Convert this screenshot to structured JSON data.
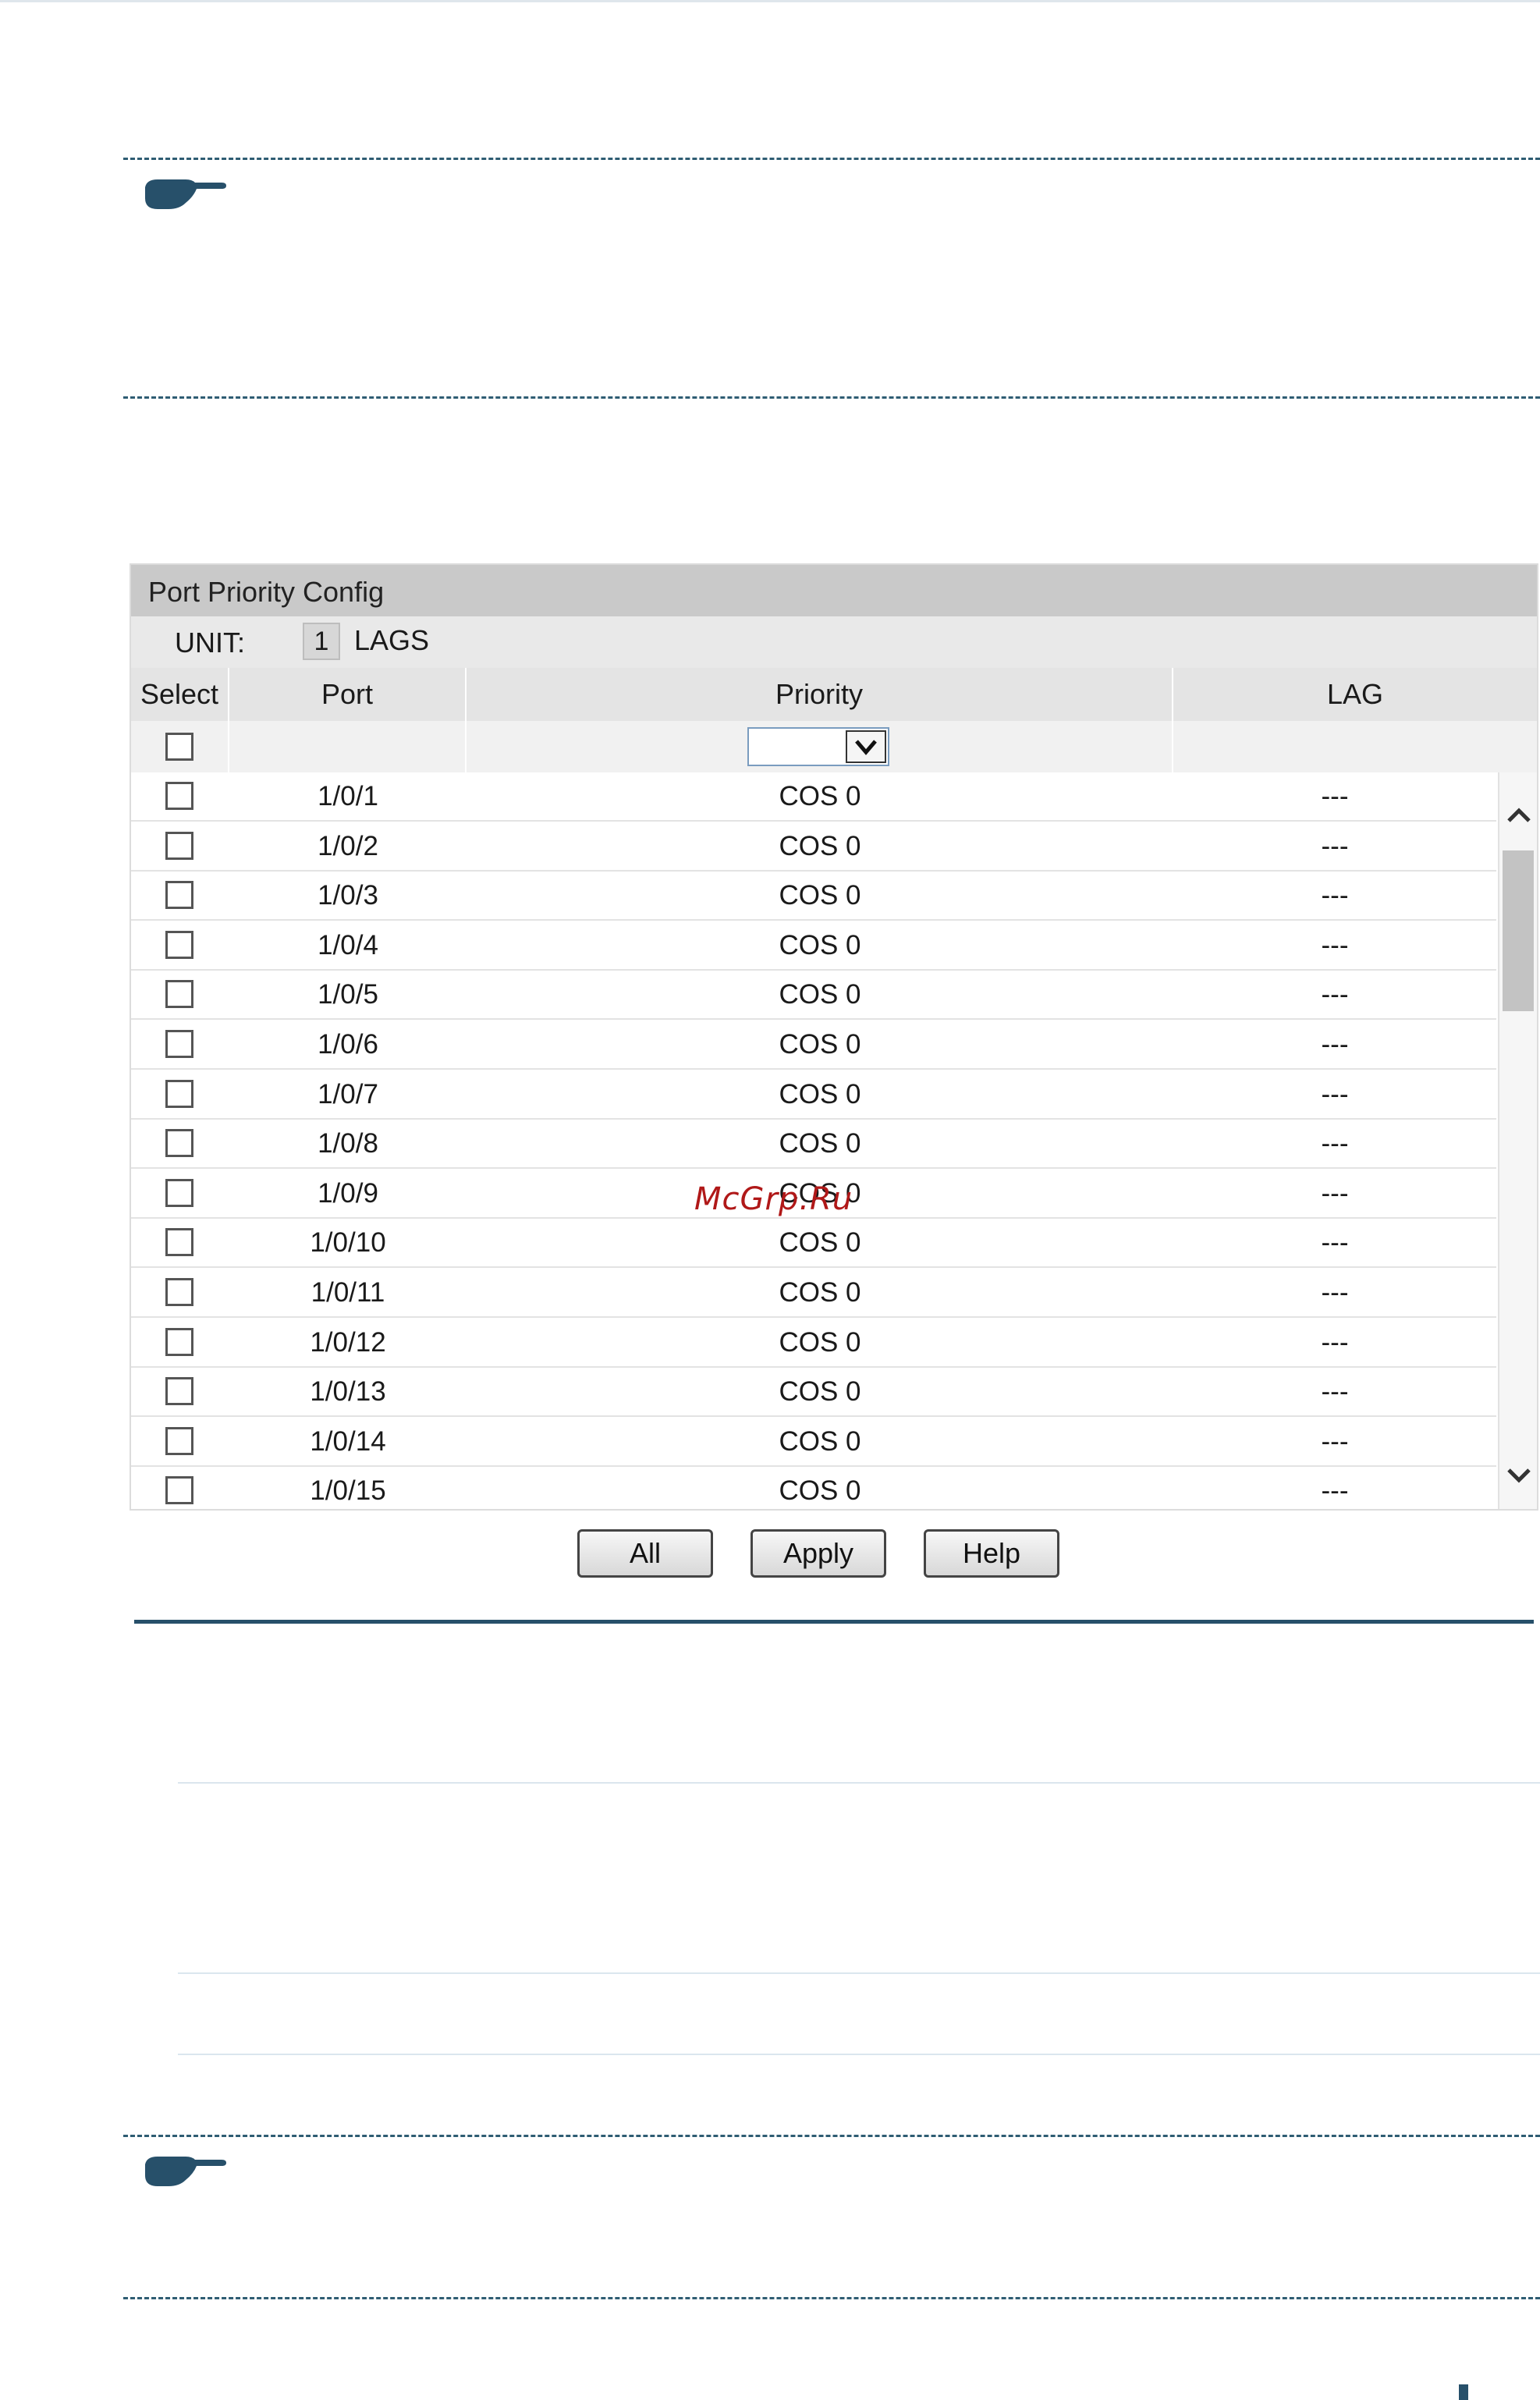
{
  "panel": {
    "title": "Port Priority Config",
    "unit_label": "UNIT:",
    "unit_value": "1",
    "lags_label": "LAGS"
  },
  "table": {
    "headers": {
      "select": "Select",
      "port": "Port",
      "priority": "Priority",
      "lag": "LAG"
    },
    "priority_filter_value": "",
    "rows": [
      {
        "port": "1/0/1",
        "priority": "COS 0",
        "lag": "---"
      },
      {
        "port": "1/0/2",
        "priority": "COS 0",
        "lag": "---"
      },
      {
        "port": "1/0/3",
        "priority": "COS 0",
        "lag": "---"
      },
      {
        "port": "1/0/4",
        "priority": "COS 0",
        "lag": "---"
      },
      {
        "port": "1/0/5",
        "priority": "COS 0",
        "lag": "---"
      },
      {
        "port": "1/0/6",
        "priority": "COS 0",
        "lag": "---"
      },
      {
        "port": "1/0/7",
        "priority": "COS 0",
        "lag": "---"
      },
      {
        "port": "1/0/8",
        "priority": "COS 0",
        "lag": "---"
      },
      {
        "port": "1/0/9",
        "priority": "COS 0",
        "lag": "---"
      },
      {
        "port": "1/0/10",
        "priority": "COS 0",
        "lag": "---"
      },
      {
        "port": "1/0/11",
        "priority": "COS 0",
        "lag": "---"
      },
      {
        "port": "1/0/12",
        "priority": "COS 0",
        "lag": "---"
      },
      {
        "port": "1/0/13",
        "priority": "COS 0",
        "lag": "---"
      },
      {
        "port": "1/0/14",
        "priority": "COS 0",
        "lag": "---"
      },
      {
        "port": "1/0/15",
        "priority": "COS 0",
        "lag": "---"
      }
    ]
  },
  "buttons": {
    "all": "All",
    "apply": "Apply",
    "help": "Help"
  },
  "watermark": "McGrp.Ru",
  "icons": [
    "note-hand-icon",
    "chevron-down-icon",
    "scroll-up-icon",
    "scroll-down-icon"
  ],
  "colors": {
    "accent": "#27506a",
    "header_bg": "#c9c9c9",
    "watermark": "#b01818"
  }
}
